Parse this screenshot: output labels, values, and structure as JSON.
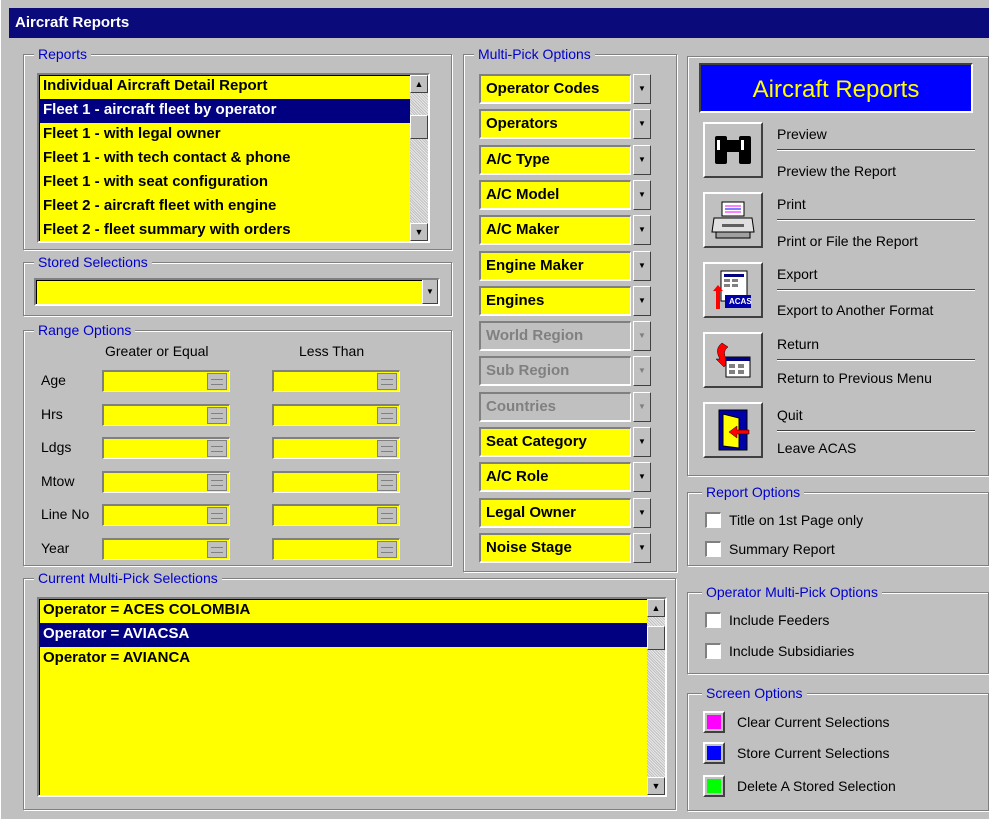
{
  "window": {
    "title": "Aircraft Reports"
  },
  "reports": {
    "legend": "Reports",
    "items": [
      "Individual Aircraft Detail Report",
      "Fleet 1 - aircraft fleet by operator",
      "Fleet 1 - with legal owner",
      "Fleet 1 - with tech contact & phone",
      "Fleet 1 - with seat configuration",
      "Fleet 2 - aircraft fleet with engine",
      "Fleet 2 - fleet summary with orders"
    ],
    "selected": "Fleet 1 - aircraft fleet by operator"
  },
  "stored": {
    "legend": "Stored Selections",
    "value": ""
  },
  "range": {
    "legend": "Range Options",
    "col_ge": "Greater or Equal",
    "col_lt": "Less Than",
    "rows": [
      "Age",
      "Hrs",
      "Ldgs",
      "Mtow",
      "Line No",
      "Year"
    ]
  },
  "multipick": {
    "legend": "Multi-Pick Options",
    "items": [
      {
        "label": "Operator Codes",
        "enabled": true
      },
      {
        "label": "Operators",
        "enabled": true
      },
      {
        "label": "A/C Type",
        "enabled": true
      },
      {
        "label": "A/C Model",
        "enabled": true
      },
      {
        "label": "A/C Maker",
        "enabled": true
      },
      {
        "label": "Engine Maker",
        "enabled": true
      },
      {
        "label": "Engines",
        "enabled": true
      },
      {
        "label": "World Region",
        "enabled": false
      },
      {
        "label": "Sub Region",
        "enabled": false
      },
      {
        "label": "Countries",
        "enabled": false
      },
      {
        "label": "Seat Category",
        "enabled": true
      },
      {
        "label": "A/C Role",
        "enabled": true
      },
      {
        "label": "Legal Owner",
        "enabled": true
      },
      {
        "label": "Noise Stage",
        "enabled": true
      }
    ]
  },
  "current": {
    "legend": "Current Multi-Pick Selections",
    "items": [
      "Operator = ACES COLOMBIA",
      "Operator = AVIACSA",
      "Operator = AVIANCA"
    ],
    "selected": "Operator = AVIACSA"
  },
  "banner": {
    "text": "Aircraft Reports",
    "bg": "#0000ff",
    "fg": "#ffff00"
  },
  "actions": [
    {
      "title": "Preview",
      "desc": "Preview the Report",
      "icon": "binoculars-icon"
    },
    {
      "title": "Print",
      "desc": "Print or File the Report",
      "icon": "printer-icon"
    },
    {
      "title": "Export",
      "desc": "Export to Another Format",
      "icon": "export-icon"
    },
    {
      "title": "Return",
      "desc": "Return to Previous Menu",
      "icon": "return-icon"
    },
    {
      "title": "Quit",
      "desc": "Leave  ACAS",
      "icon": "exit-door-icon"
    }
  ],
  "export_icon_text": "ACAS",
  "report_options": {
    "legend": "Report Options",
    "title_first_page": "Title on 1st Page only",
    "summary": "Summary Report"
  },
  "operator_options": {
    "legend": "Operator Multi-Pick Options",
    "feeders": "Include Feeders",
    "subsidiaries": "Include Subsidiaries"
  },
  "screen_options": {
    "legend": "Screen Options",
    "clear": "Clear Current Selections",
    "store": "Store Current Selections",
    "delete": "Delete A Stored Selection",
    "colors": {
      "clear": "#ff00ff",
      "store": "#0000ff",
      "delete": "#00ff00"
    }
  }
}
